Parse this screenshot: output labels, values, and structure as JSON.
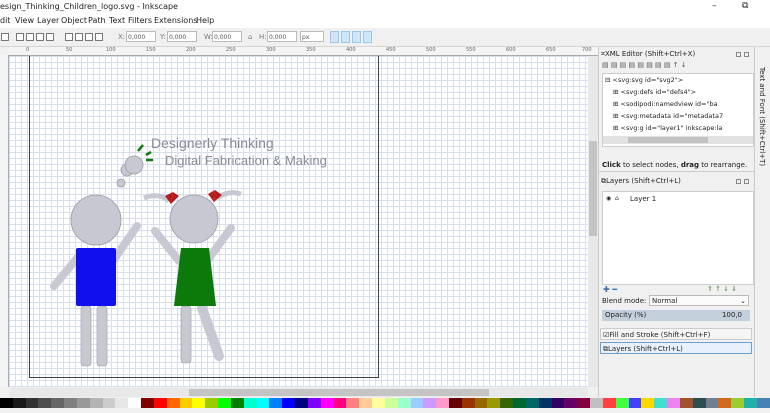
{
  "window": {
    "title": "esign_Thinking_Children_logo.svg - Inkscape",
    "minimize_glyph": "–",
    "restore_glyph": "⧉"
  },
  "menu": {
    "items": [
      "dit",
      "View",
      "Layer",
      "Object",
      "Path",
      "Text",
      "Filters",
      "Extensions",
      "Help"
    ]
  },
  "toolbar": {
    "x_label": "X:",
    "x_value": "0,000",
    "y_label": "Y:",
    "y_value": "0,000",
    "w_label": "W:",
    "w_value": "0,000",
    "h_label": "H:",
    "h_value": "0,000",
    "unit": "px"
  },
  "ruler": {
    "labels": [
      "0",
      "50",
      "100",
      "150",
      "200",
      "250",
      "300",
      "350",
      "400",
      "450",
      "500",
      "550",
      "600",
      "650",
      "700"
    ]
  },
  "artwork": {
    "line1": "Designerly Thinking",
    "line2": "Digital Fabrication & Making",
    "colors": {
      "body_gray": "#c8c8d2",
      "shirt_blue": "#1010ee",
      "dress_green": "#0b7a0b",
      "bow_red": "#b51c1c",
      "text_gray": "#8a8a96"
    }
  },
  "xml_editor": {
    "title": "XML Editor (Shift+Ctrl+X)",
    "nodes": [
      "<svg:svg id=\"svg2\">",
      "<svg:defs id=\"defs4\">",
      "<sodipodi:namedview id=\"ba",
      "<svg:metadata id=\"metadata7",
      "<svg:g id=\"layer1\" inkscape:la"
    ],
    "hint_bold1": "Click",
    "hint_mid": " to select nodes, ",
    "hint_bold2": "drag",
    "hint_end": " to rearrange."
  },
  "layers": {
    "title": "Layers (Shift+Ctrl+L)",
    "layer_name": "Layer 1",
    "blend_label": "Blend mode:",
    "blend_value": "Normal",
    "opacity_label": "Opacity (%)",
    "opacity_value": "100,0"
  },
  "collapsed_panels": {
    "fill_stroke": "Fill and Stroke (Shift+Ctrl+F)",
    "layers_tab": "Layers (Shift+Ctrl+L)"
  },
  "side_tab": "Text and Font (Shift+Ctrl+T)",
  "palette_colors": [
    "#000000",
    "#1a1a1a",
    "#333333",
    "#4d4d4d",
    "#666666",
    "#808080",
    "#999999",
    "#b3b3b3",
    "#cccccc",
    "#e6e6e6",
    "#ffffff",
    "#800000",
    "#ff0000",
    "#ff6600",
    "#ffcc00",
    "#ffff00",
    "#99cc00",
    "#00ff00",
    "#008000",
    "#00ffcc",
    "#00ffff",
    "#0080ff",
    "#0000ff",
    "#000080",
    "#8000ff",
    "#ff00ff",
    "#ff0080",
    "#ff8080",
    "#ffcc99",
    "#ffff99",
    "#ccff99",
    "#99ffcc",
    "#99ccff",
    "#cc99ff",
    "#ff99cc",
    "#660000",
    "#993300",
    "#996600",
    "#999900",
    "#336600",
    "#006633",
    "#006666",
    "#003366",
    "#330066",
    "#660066",
    "#800040",
    "#c0c0c0",
    "#ff4040",
    "#40ff40",
    "#4040ff",
    "#ffd700",
    "#40e0d0",
    "#ee82ee",
    "#a0522d",
    "#2f4f4f",
    "#708090",
    "#d2691e",
    "#9acd32",
    "#20b2aa",
    "#4682b4"
  ]
}
